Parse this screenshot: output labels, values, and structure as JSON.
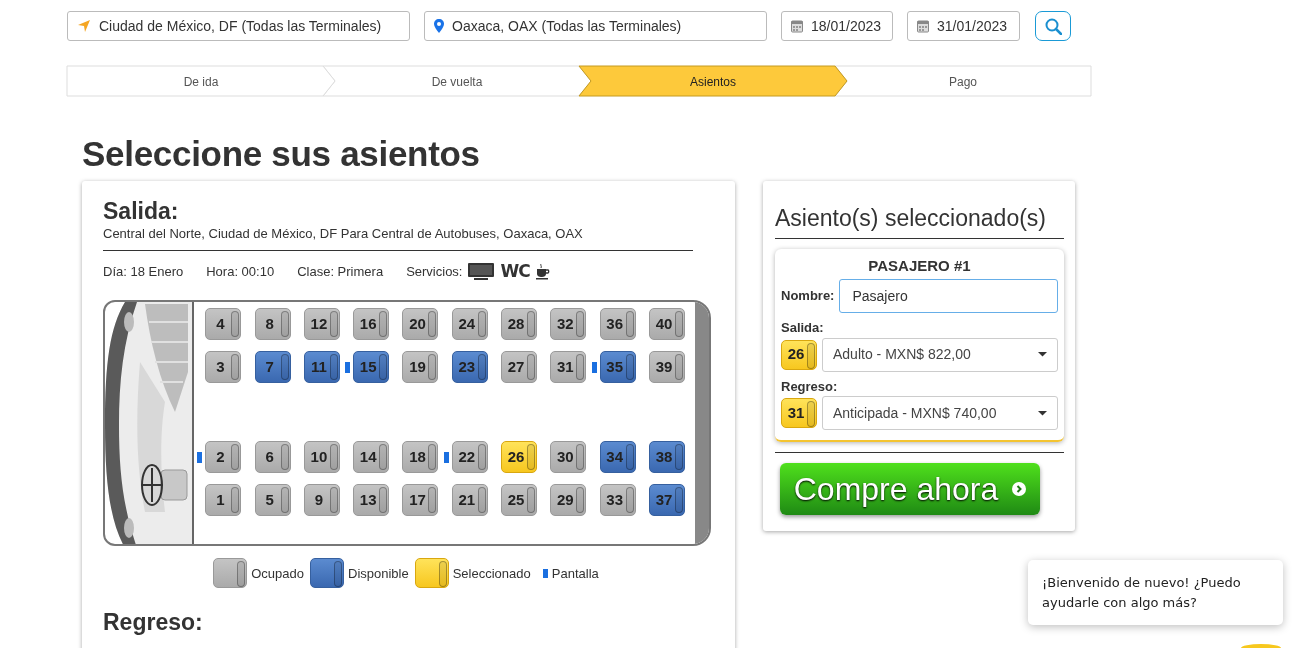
{
  "search": {
    "origin": "Ciudad de México, DF (Todas las Terminales)",
    "destination": "Oaxaca, OAX (Todas las Terminales)",
    "depart_date": "18/01/2023",
    "return_date": "31/01/2023"
  },
  "steps": [
    {
      "label": "De ida",
      "selected": false
    },
    {
      "label": "De vuelta",
      "selected": false
    },
    {
      "label": "Asientos",
      "selected": true
    },
    {
      "label": "Pago",
      "selected": false
    }
  ],
  "heading": "Seleccione sus asientos",
  "trip": {
    "title": "Salida:",
    "route": "Central del Norte, Ciudad de México, DF Para Central de Autobuses, Oaxaca, OAX",
    "details": [
      "Día: 18 Enero",
      "Hora: 00:10",
      "Clase: Primera"
    ],
    "services_label": "Servicios:",
    "services": [
      {
        "kind": "tv"
      },
      {
        "kind": "wc",
        "text": "WC"
      },
      {
        "kind": "coffee"
      }
    ]
  },
  "bus": {
    "seat_rows": [
      {
        "seats": [
          {
            "number": "4",
            "kind": "occupied",
            "screen": false
          },
          {
            "number": "8",
            "kind": "occupied",
            "screen": false
          },
          {
            "number": "12",
            "kind": "occupied",
            "screen": false
          },
          {
            "number": "16",
            "kind": "occupied",
            "screen": false
          },
          {
            "number": "20",
            "kind": "occupied",
            "screen": false
          },
          {
            "number": "24",
            "kind": "occupied",
            "screen": false
          },
          {
            "number": "28",
            "kind": "occupied",
            "screen": false
          },
          {
            "number": "32",
            "kind": "occupied",
            "screen": false
          },
          {
            "number": "36",
            "kind": "occupied",
            "screen": false
          },
          {
            "number": "40",
            "kind": "occupied",
            "screen": false
          }
        ]
      },
      {
        "seats": [
          {
            "number": "3",
            "kind": "occupied",
            "screen": false
          },
          {
            "number": "7",
            "kind": "available",
            "screen": false
          },
          {
            "number": "11",
            "kind": "available",
            "screen": false
          },
          {
            "number": "15",
            "kind": "available",
            "screen": true
          },
          {
            "number": "19",
            "kind": "occupied",
            "screen": false
          },
          {
            "number": "23",
            "kind": "available",
            "screen": false
          },
          {
            "number": "27",
            "kind": "occupied",
            "screen": false
          },
          {
            "number": "31",
            "kind": "occupied",
            "screen": false
          },
          {
            "number": "35",
            "kind": "available",
            "screen": true
          },
          {
            "number": "39",
            "kind": "occupied",
            "screen": false
          }
        ]
      },
      {
        "seats": [
          {
            "number": "2",
            "kind": "occupied",
            "screen": true
          },
          {
            "number": "6",
            "kind": "occupied",
            "screen": false
          },
          {
            "number": "10",
            "kind": "occupied",
            "screen": false
          },
          {
            "number": "14",
            "kind": "occupied",
            "screen": false
          },
          {
            "number": "18",
            "kind": "occupied",
            "screen": false
          },
          {
            "number": "22",
            "kind": "occupied",
            "screen": true
          },
          {
            "number": "26",
            "kind": "selected",
            "screen": false
          },
          {
            "number": "30",
            "kind": "occupied",
            "screen": false
          },
          {
            "number": "34",
            "kind": "available",
            "screen": false
          },
          {
            "number": "38",
            "kind": "available",
            "screen": false
          }
        ]
      },
      {
        "seats": [
          {
            "number": "1",
            "kind": "occupied",
            "screen": false
          },
          {
            "number": "5",
            "kind": "occupied",
            "screen": false
          },
          {
            "number": "9",
            "kind": "occupied",
            "screen": false
          },
          {
            "number": "13",
            "kind": "occupied",
            "screen": false
          },
          {
            "number": "17",
            "kind": "occupied",
            "screen": false
          },
          {
            "number": "21",
            "kind": "occupied",
            "screen": false
          },
          {
            "number": "25",
            "kind": "occupied",
            "screen": false
          },
          {
            "number": "29",
            "kind": "occupied",
            "screen": false
          },
          {
            "number": "33",
            "kind": "occupied",
            "screen": false
          },
          {
            "number": "37",
            "kind": "available",
            "screen": false
          }
        ]
      }
    ]
  },
  "legend": [
    {
      "kind": "occupied",
      "label": "Ocupado"
    },
    {
      "kind": "available",
      "label": "Disponible"
    },
    {
      "kind": "selected",
      "label": "Seleccionado"
    },
    {
      "kind": "screen",
      "label": "Pantalla"
    }
  ],
  "return_title": "Regreso:",
  "selection": {
    "title": "Asiento(s) seleccionado(s)",
    "passengers": [
      {
        "title": "PASAJERO #1",
        "name_label": "Nombre:",
        "name_value": "Pasajero",
        "legs": [
          {
            "label": "Salida:",
            "seat": "26",
            "fare": "Adulto - MXN$ 822,00"
          },
          {
            "label": "Regreso:",
            "seat": "31",
            "fare": "Anticipada - MXN$ 740,00"
          }
        ]
      }
    ],
    "buy_button": "Compre ahora"
  },
  "chat": {
    "message": "¡Bienvenido de nuevo! ¿Puedo ayudarle con algo más?"
  }
}
